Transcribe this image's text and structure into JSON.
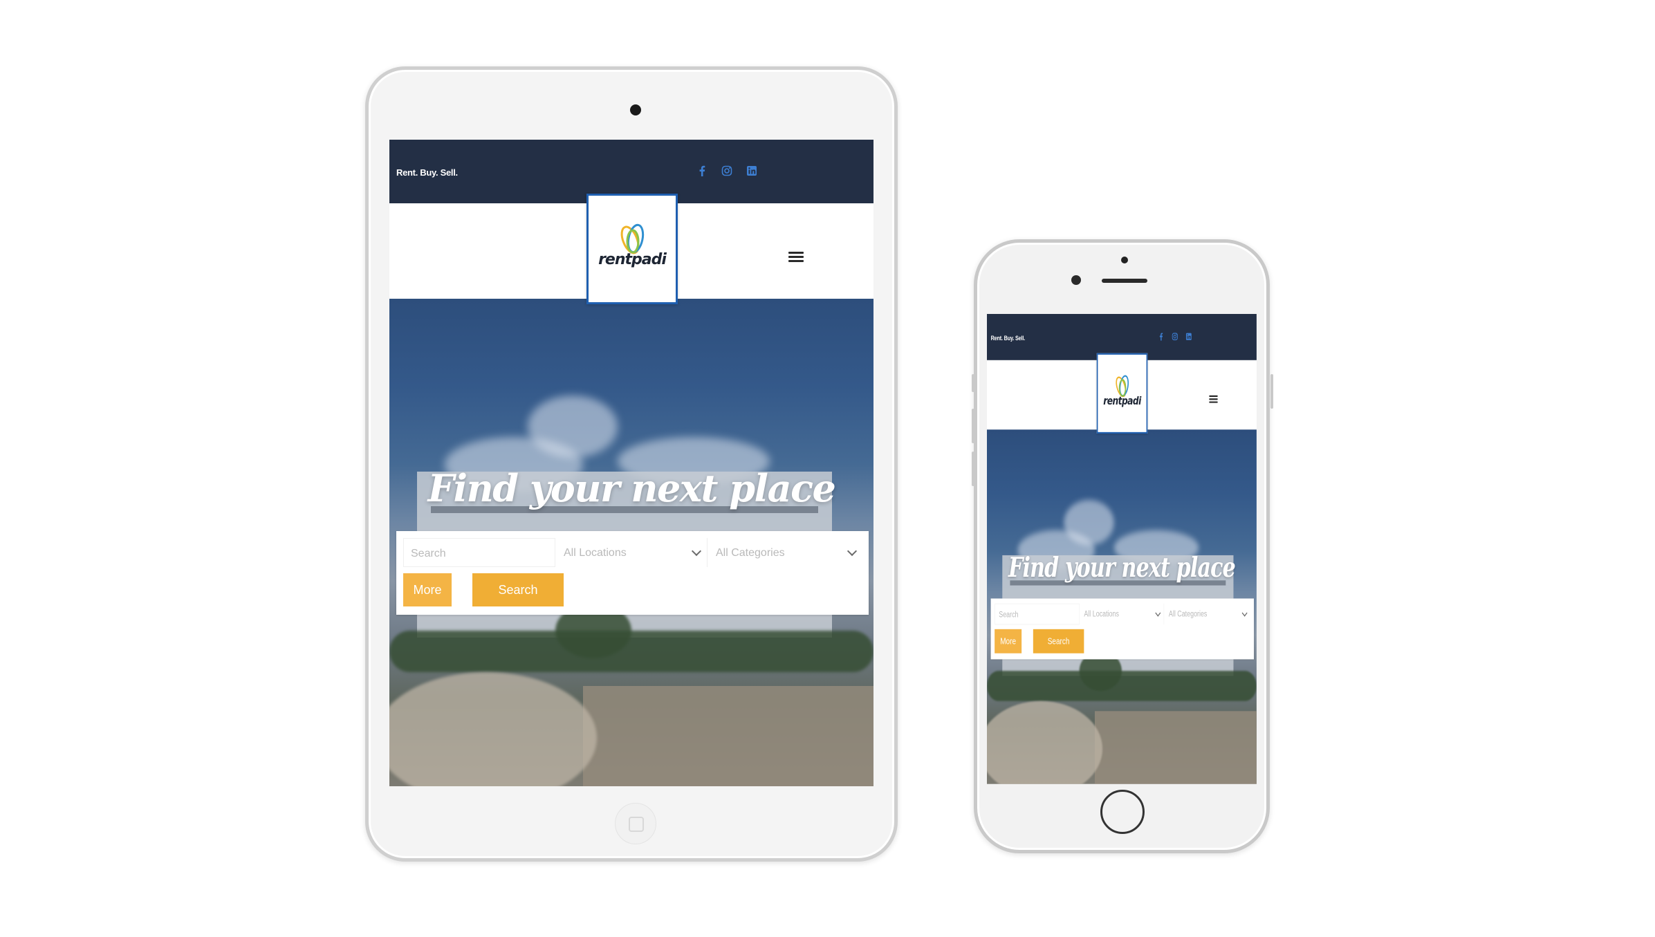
{
  "site": {
    "tagline": "Rent. Buy. Sell.",
    "brand": "rentpadi",
    "social_icons": [
      "facebook-icon",
      "instagram-icon",
      "linkedin-icon"
    ],
    "menu_icon": "hamburger-menu-icon",
    "hero_title": "Find your next place",
    "search": {
      "placeholder": "Search",
      "location_select": "All Locations",
      "category_select": "All Categories",
      "more_label": "More",
      "search_label": "Search"
    },
    "colors": {
      "topbar": "#232f45",
      "accent": "#f0ae35",
      "social": "#3d7fd3",
      "logo_border": "#1f5fb0"
    }
  },
  "devices": [
    "tablet",
    "phone"
  ]
}
